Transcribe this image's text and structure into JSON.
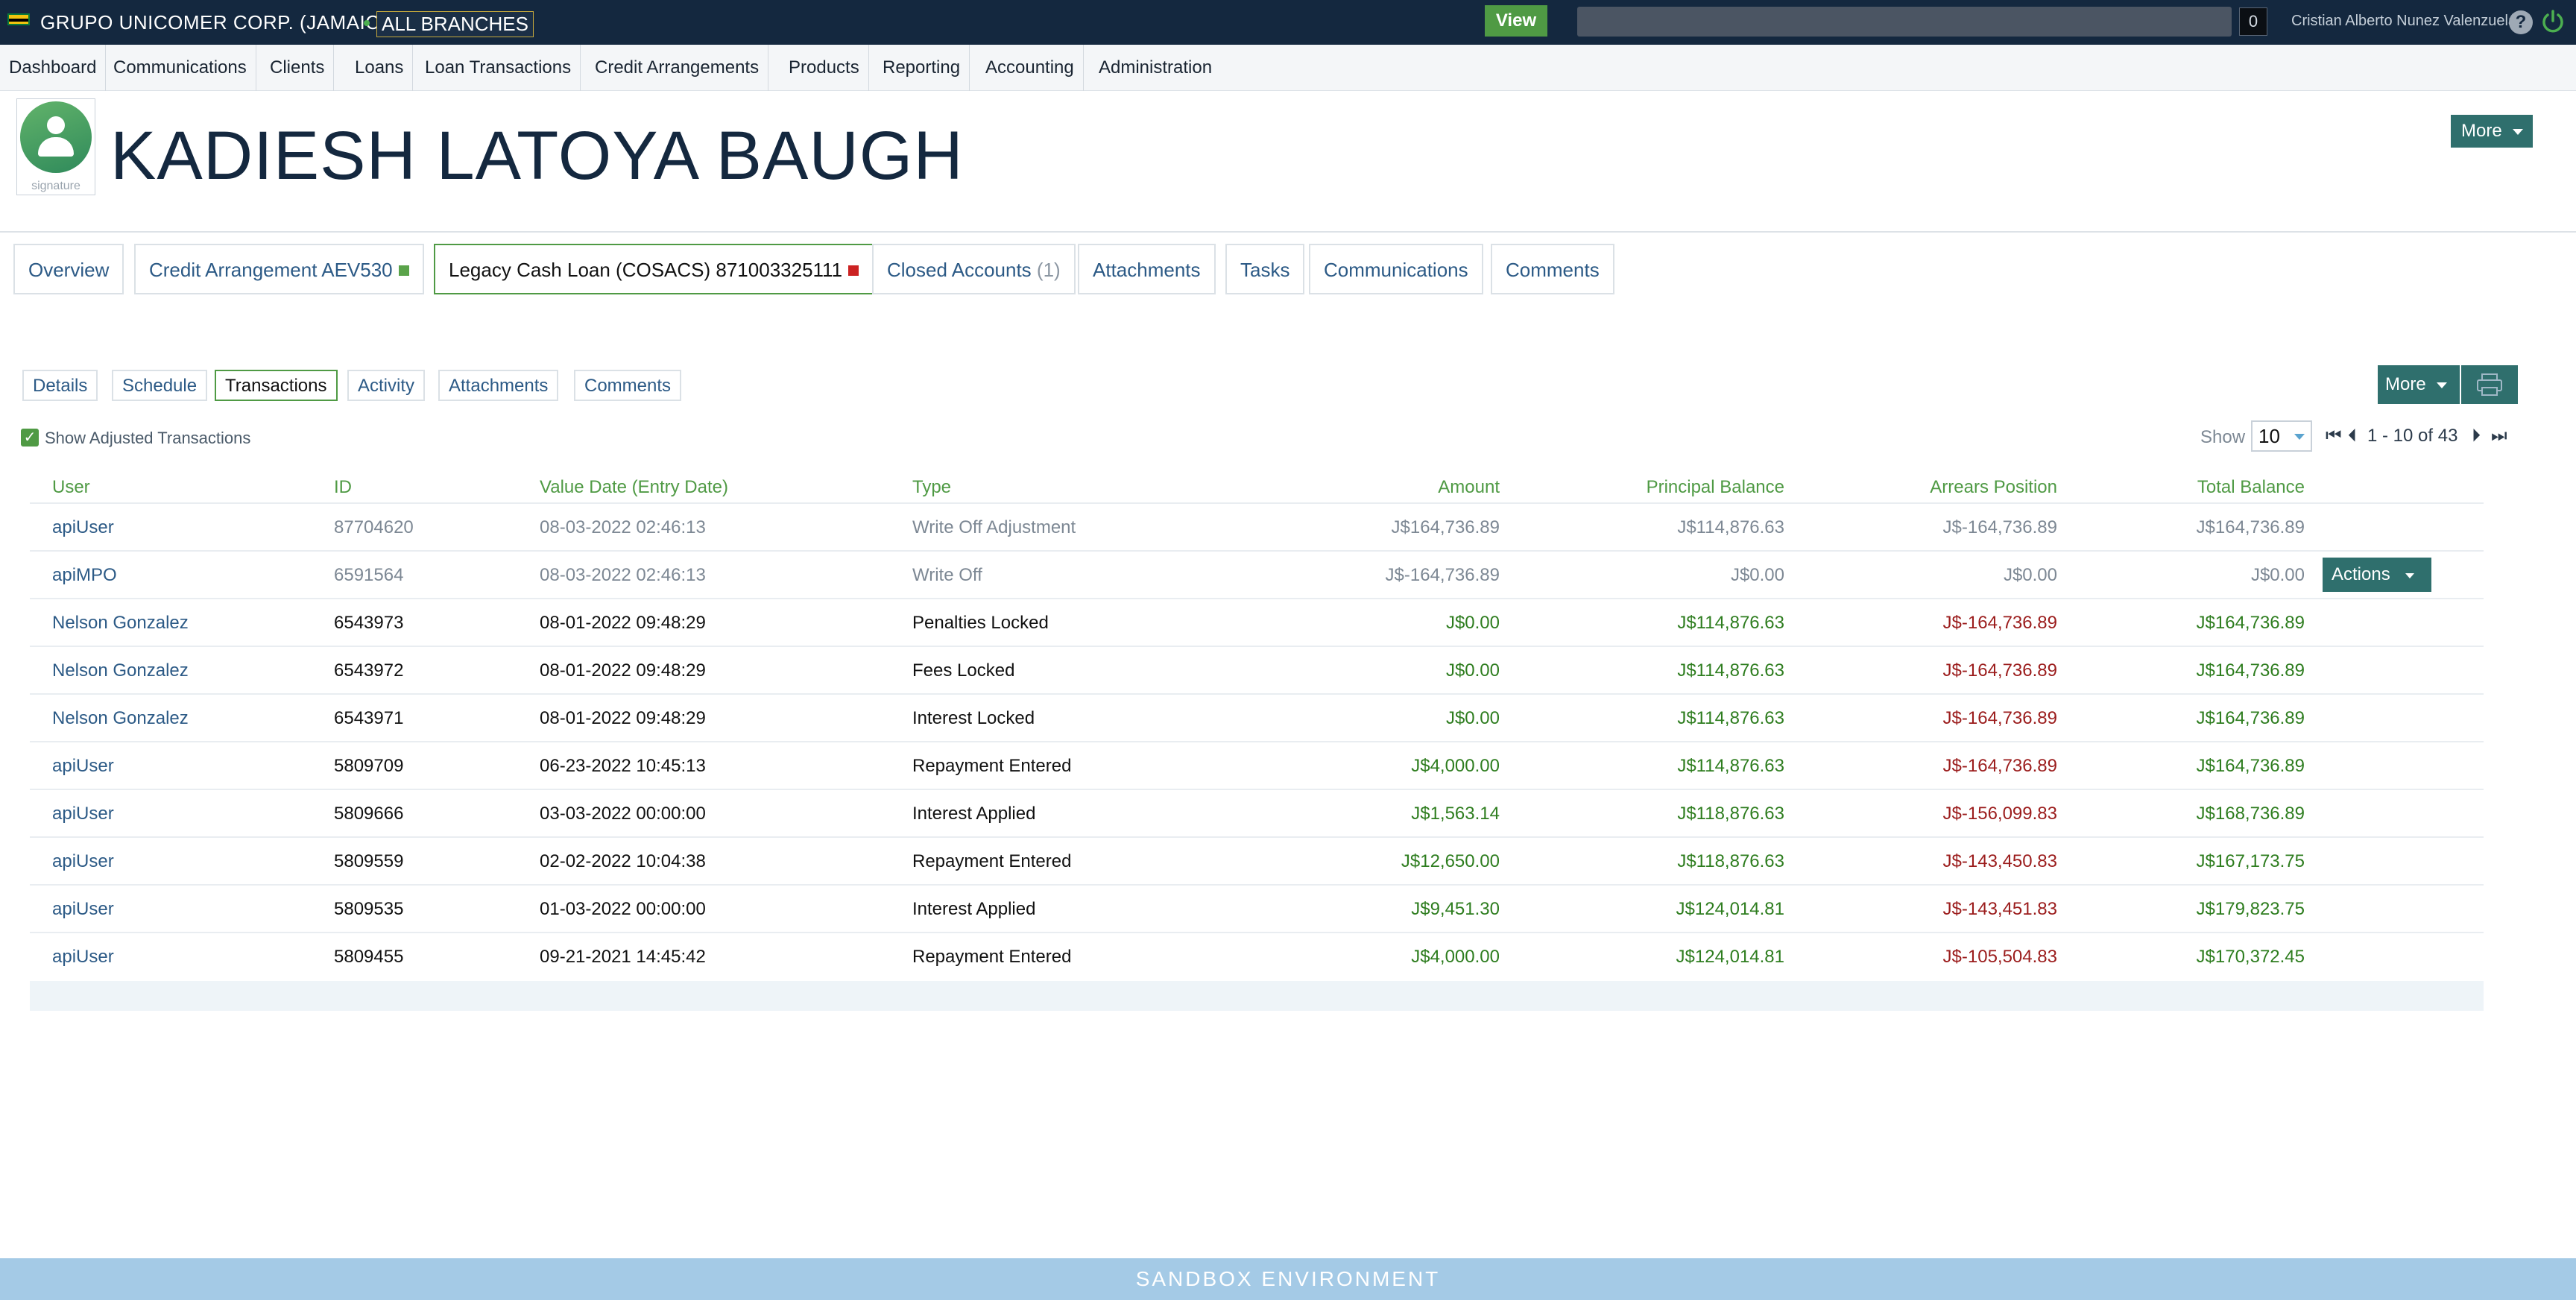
{
  "topbar": {
    "company": "GRUPO UNICOMER CORP. (JAMAICA)",
    "branch": "ALL BRANCHES",
    "view_label": "View",
    "counter": "0",
    "user": "Cristian Alberto Nunez Valenzuela"
  },
  "nav": [
    "Dashboard",
    "Communications",
    "Clients",
    "Loans",
    "Loan Transactions",
    "Credit Arrangements",
    "Products",
    "Reporting",
    "Accounting",
    "Administration"
  ],
  "header": {
    "signature_label": "signature",
    "client_name": "KADIESH LATOYA BAUGH",
    "more_label": "More"
  },
  "account_tabs": {
    "overview": "Overview",
    "credit": "Credit Arrangement AEV530",
    "legacy": "Legacy Cash Loan (COSACS) 871003325111",
    "closed": "Closed Accounts",
    "closed_count": "(1)",
    "attachments": "Attachments",
    "tasks": "Tasks",
    "communications": "Communications",
    "comments": "Comments",
    "credit_status_color": "#5aa34a",
    "legacy_status_color": "#cc2222"
  },
  "sub_tabs": [
    "Details",
    "Schedule",
    "Transactions",
    "Activity",
    "Attachments",
    "Comments"
  ],
  "toolbar": {
    "more_label": "More",
    "show_adjusted": "Show Adjusted Transactions",
    "show_label": "Show",
    "page_size": "10",
    "range": "1 - 10 of 43"
  },
  "table": {
    "headers": [
      "User",
      "ID",
      "Value Date (Entry Date)",
      "Type",
      "Amount",
      "Principal Balance",
      "Arrears Position",
      "Total Balance"
    ],
    "actions_label": "Actions",
    "rows": [
      {
        "user": "apiUser",
        "id": "87704620",
        "date": "08-03-2022 02:46:13",
        "type": "Write Off Adjustment",
        "amount": "J$164,736.89",
        "principal": "J$114,876.63",
        "arrears": "J$-164,736.89",
        "total": "J$164,736.89",
        "adjusted": true
      },
      {
        "user": "apiMPO",
        "id": "6591564",
        "date": "08-03-2022 02:46:13",
        "type": "Write Off",
        "amount": "J$-164,736.89",
        "principal": "J$0.00",
        "arrears": "J$0.00",
        "total": "J$0.00",
        "adjusted": true
      },
      {
        "user": "Nelson Gonzalez",
        "id": "6543973",
        "date": "08-01-2022 09:48:29",
        "type": "Penalties Locked",
        "amount": "J$0.00",
        "principal": "J$114,876.63",
        "arrears": "J$-164,736.89",
        "total": "J$164,736.89",
        "adjusted": false
      },
      {
        "user": "Nelson Gonzalez",
        "id": "6543972",
        "date": "08-01-2022 09:48:29",
        "type": "Fees Locked",
        "amount": "J$0.00",
        "principal": "J$114,876.63",
        "arrears": "J$-164,736.89",
        "total": "J$164,736.89",
        "adjusted": false
      },
      {
        "user": "Nelson Gonzalez",
        "id": "6543971",
        "date": "08-01-2022 09:48:29",
        "type": "Interest Locked",
        "amount": "J$0.00",
        "principal": "J$114,876.63",
        "arrears": "J$-164,736.89",
        "total": "J$164,736.89",
        "adjusted": false
      },
      {
        "user": "apiUser",
        "id": "5809709",
        "date": "06-23-2022 10:45:13",
        "type": "Repayment Entered",
        "amount": "J$4,000.00",
        "principal": "J$114,876.63",
        "arrears": "J$-164,736.89",
        "total": "J$164,736.89",
        "adjusted": false
      },
      {
        "user": "apiUser",
        "id": "5809666",
        "date": "03-03-2022 00:00:00",
        "type": "Interest Applied",
        "amount": "J$1,563.14",
        "principal": "J$118,876.63",
        "arrears": "J$-156,099.83",
        "total": "J$168,736.89",
        "adjusted": false
      },
      {
        "user": "apiUser",
        "id": "5809559",
        "date": "02-02-2022 10:04:38",
        "type": "Repayment Entered",
        "amount": "J$12,650.00",
        "principal": "J$118,876.63",
        "arrears": "J$-143,450.83",
        "total": "J$167,173.75",
        "adjusted": false
      },
      {
        "user": "apiUser",
        "id": "5809535",
        "date": "01-03-2022 00:00:00",
        "type": "Interest Applied",
        "amount": "J$9,451.30",
        "principal": "J$124,014.81",
        "arrears": "J$-143,451.83",
        "total": "J$179,823.75",
        "adjusted": false
      },
      {
        "user": "apiUser",
        "id": "5809455",
        "date": "09-21-2021 14:45:42",
        "type": "Repayment Entered",
        "amount": "J$4,000.00",
        "principal": "J$124,014.81",
        "arrears": "J$-105,504.83",
        "total": "J$170,372.45",
        "adjusted": false
      }
    ]
  },
  "footer": {
    "text": "SANDBOX ENVIRONMENT"
  },
  "colors": {
    "positive": "#2e7d1f",
    "negative": "#9b1c1c",
    "muted": "#7d8894",
    "link": "#2c5a86",
    "accent": "#4f9a44"
  }
}
